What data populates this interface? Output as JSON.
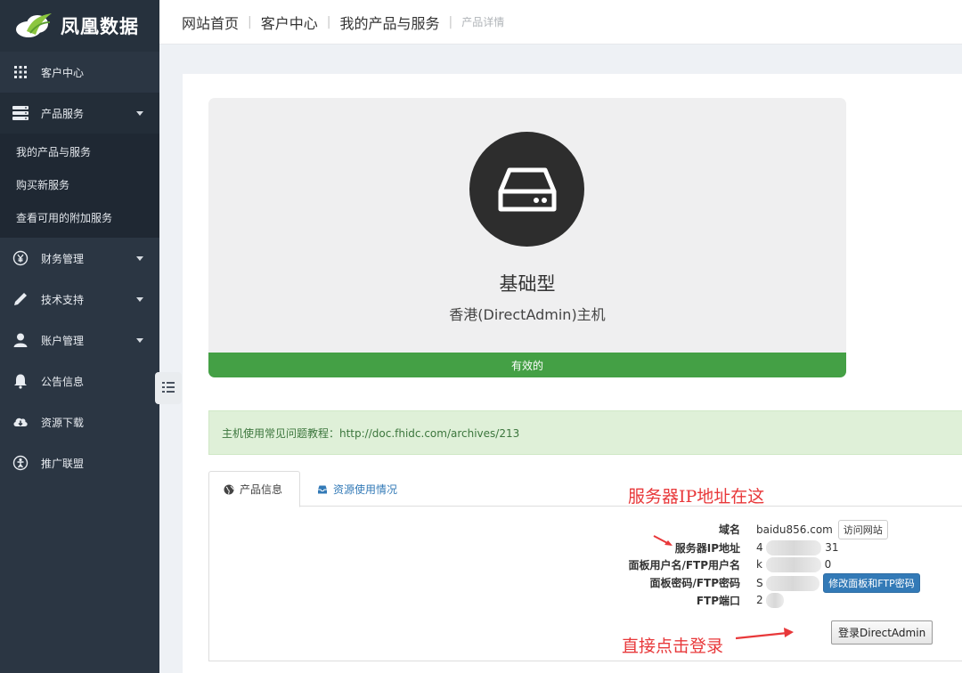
{
  "brand": {
    "name": "凤凰数据"
  },
  "sidebar": {
    "items": [
      {
        "label": "客户中心",
        "icon": "grid-icon"
      },
      {
        "label": "产品服务",
        "icon": "server-icon"
      },
      {
        "label": "财务管理",
        "icon": "yen-icon"
      },
      {
        "label": "技术支持",
        "icon": "pencil-icon"
      },
      {
        "label": "账户管理",
        "icon": "user-icon"
      },
      {
        "label": "公告信息",
        "icon": "bell-icon"
      },
      {
        "label": "资源下载",
        "icon": "cloud-download-icon"
      },
      {
        "label": "推广联盟",
        "icon": "handshake-icon"
      }
    ],
    "submenu": [
      "我的产品与服务",
      "购买新服务",
      "查看可用的附加服务"
    ]
  },
  "breadcrumb": [
    "网站首页",
    "客户中心",
    "我的产品与服务",
    "产品详情"
  ],
  "product": {
    "name": "基础型",
    "group": "香港(DirectAdmin)主机",
    "status": "有效的"
  },
  "alert": {
    "text": "主机使用常见问题教程：http://doc.fhidc.com/archives/213"
  },
  "tabs": [
    "产品信息",
    "资源使用情况"
  ],
  "info": {
    "domain_label": "域名",
    "domain_value": "baidu856.com",
    "visit_button": "访问网站",
    "ip_label": "服务器IP地址",
    "ip_prefix": "4",
    "ip_suffix": "31",
    "username_label": "面板用户名/FTP用户名",
    "username_prefix": "k",
    "username_suffix": "0",
    "password_label": "面板密码/FTP密码",
    "password_prefix": "S",
    "change_password_button": "修改面板和FTP密码",
    "ftp_port_label": "FTP端口",
    "ftp_port_prefix": "2",
    "login_button": "登录DirectAdmin"
  },
  "annotations": {
    "ip_note": "服务器IP地址在这",
    "login_note": "直接点击登录"
  },
  "colors": {
    "sidebar_bg": "#2b3643",
    "status_green": "#44a045",
    "primary_blue": "#337ab7",
    "annotation_red": "#e8383a"
  }
}
